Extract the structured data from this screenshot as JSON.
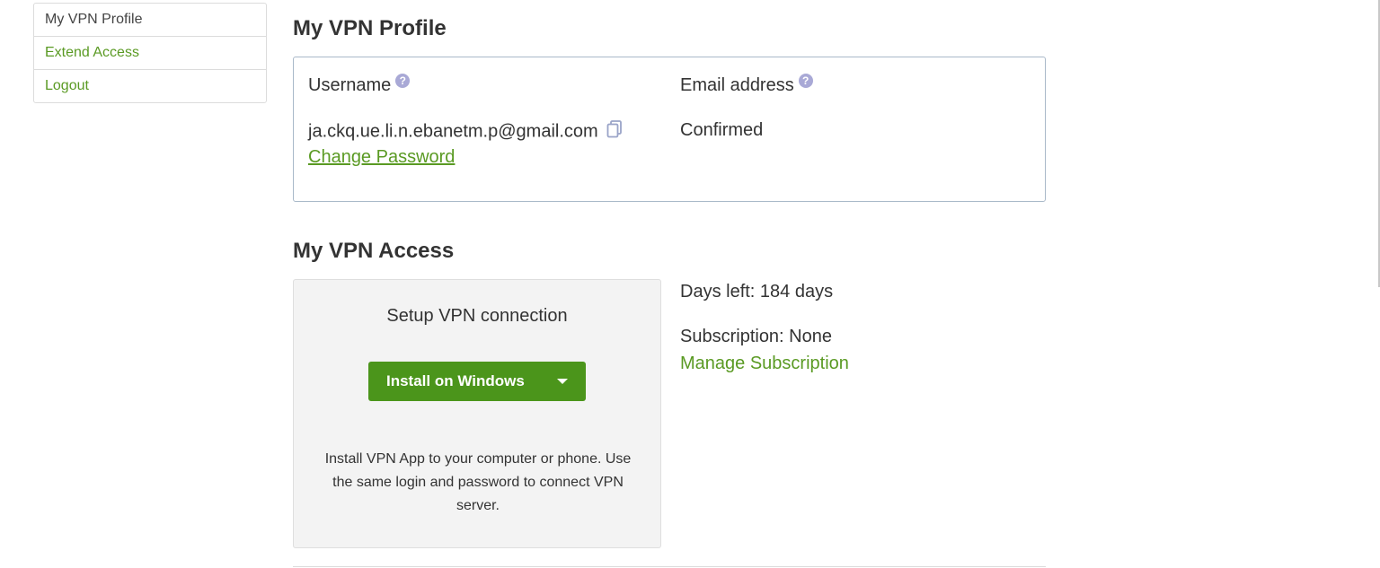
{
  "sidebar": {
    "items": [
      {
        "label": "My VPN Profile"
      },
      {
        "label": "Extend Access"
      },
      {
        "label": "Logout"
      }
    ]
  },
  "profile": {
    "title": "My VPN Profile",
    "username_label": "Username",
    "username_value": "ja.ckq.ue.li.n.ebanetm.p@gmail.com",
    "email_label": "Email address",
    "email_status": "Confirmed",
    "change_password": "Change Password",
    "help_glyph": "?"
  },
  "access": {
    "title": "My VPN Access",
    "setup_title": "Setup VPN connection",
    "install_button": "Install on Windows",
    "setup_description": "Install VPN App to your computer or phone. Use the same login and password to connect VPN server.",
    "days_left": "Days left: 184 days",
    "subscription": "Subscription: None",
    "manage_subscription": "Manage Subscription"
  },
  "colors": {
    "accent_green": "#5a9a23",
    "button_green": "#4b951b",
    "help_icon": "#a9a9d6"
  },
  "icons": {
    "help": "help-icon",
    "copy": "copy-icon",
    "dropdown": "chevron-down-icon"
  }
}
